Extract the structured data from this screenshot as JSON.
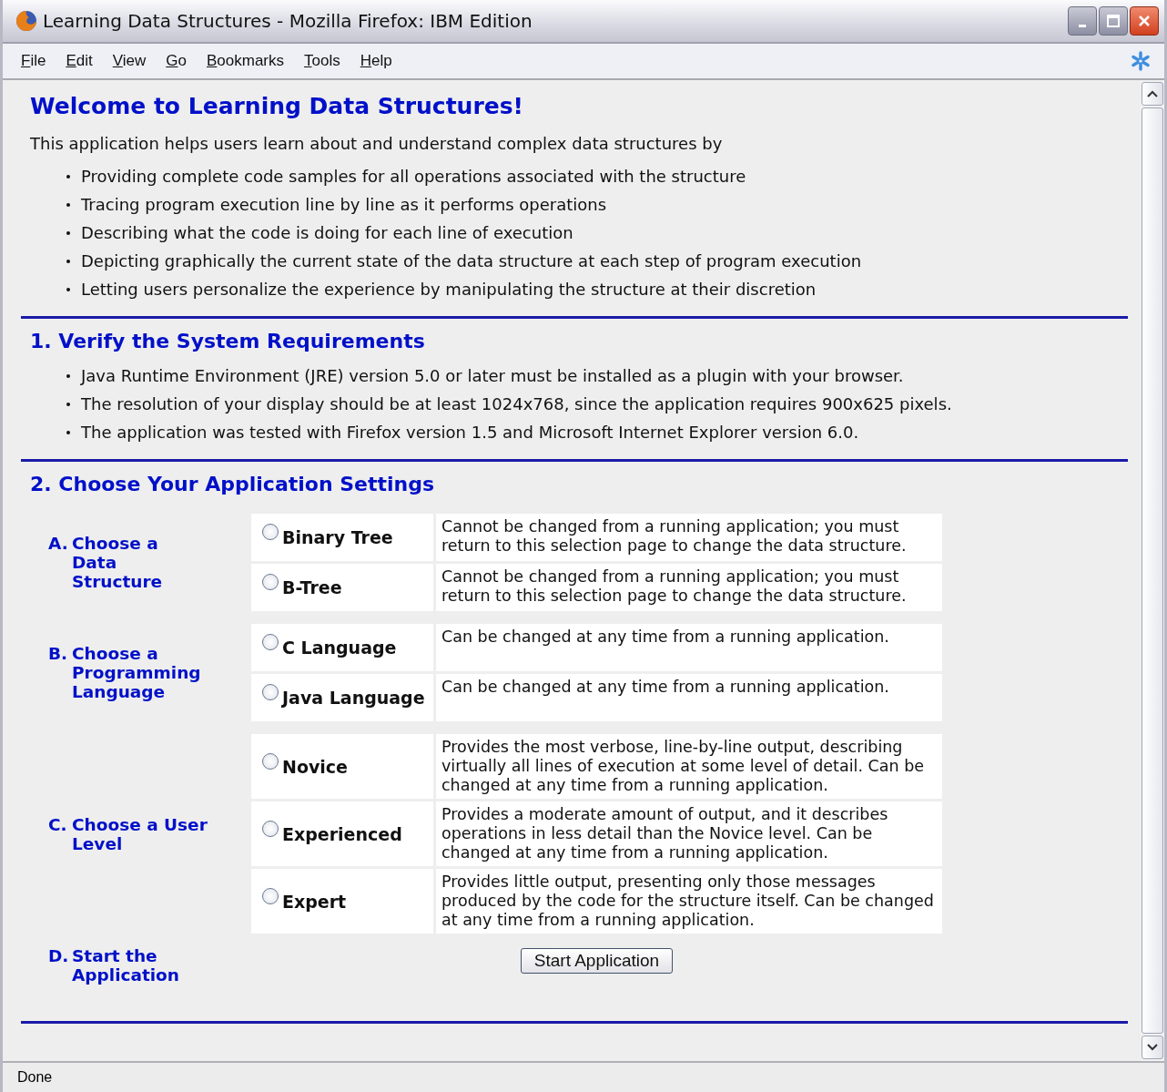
{
  "window": {
    "title": "Learning Data Structures - Mozilla Firefox: IBM Edition"
  },
  "menu": [
    "File",
    "Edit",
    "View",
    "Go",
    "Bookmarks",
    "Tools",
    "Help"
  ],
  "page": {
    "heading": "Welcome to Learning Data Structures!",
    "intro": "This application helps users learn about and understand complex data structures by",
    "features": [
      "Providing complete code samples for all operations associated with the structure",
      "Tracing program execution line by line as it performs operations",
      "Describing what the code is doing for each line of execution",
      "Depicting graphically the current state of the data structure at each step of program execution",
      "Letting users personalize the experience by manipulating the structure at their discretion"
    ],
    "requirements": {
      "heading": "1. Verify the System Requirements",
      "items": [
        "Java Runtime Environment (JRE) version 5.0 or later must be installed as a plugin with your browser.",
        "The resolution of your display should be at least 1024x768, since the application requires 900x625 pixels.",
        "The application was tested with Firefox version 1.5 and Microsoft Internet Explorer version 6.0."
      ]
    },
    "settings": {
      "heading": "2. Choose Your Application Settings",
      "groups": [
        {
          "letter": "A.",
          "label": "Choose a Data Structure",
          "options": [
            {
              "label": "Binary Tree",
              "selected": false,
              "description": "Cannot be changed from a running application; you must return to this selection page to change the data structure."
            },
            {
              "label": "B-Tree",
              "selected": false,
              "description": "Cannot be changed from a running application; you must return to this selection page to change the data structure."
            }
          ]
        },
        {
          "letter": "B.",
          "label": "Choose a Programming Language",
          "options": [
            {
              "label": "C Language",
              "selected": false,
              "description": "Can be changed at any time from a running application."
            },
            {
              "label": "Java Language",
              "selected": false,
              "description": "Can be changed at any time from a running application."
            }
          ]
        },
        {
          "letter": "C.",
          "label": "Choose a User Level",
          "options": [
            {
              "label": "Novice",
              "selected": false,
              "description": "Provides the most verbose, line-by-line output, describing virtually all lines of execution at some level of detail. Can be changed at any time from a running application."
            },
            {
              "label": "Experienced",
              "selected": false,
              "description": "Provides a moderate amount of output, and it describes operations in less detail than the Novice level. Can be changed at any time from a running application."
            },
            {
              "label": "Expert",
              "selected": false,
              "description": "Provides little output, presenting only those messages produced by the code for the structure itself. Can be changed at any time from a running application."
            }
          ]
        }
      ],
      "start": {
        "letter": "D.",
        "label": "Start the Application",
        "button": "Start Application"
      }
    }
  },
  "status_bar": {
    "text": "Done"
  }
}
